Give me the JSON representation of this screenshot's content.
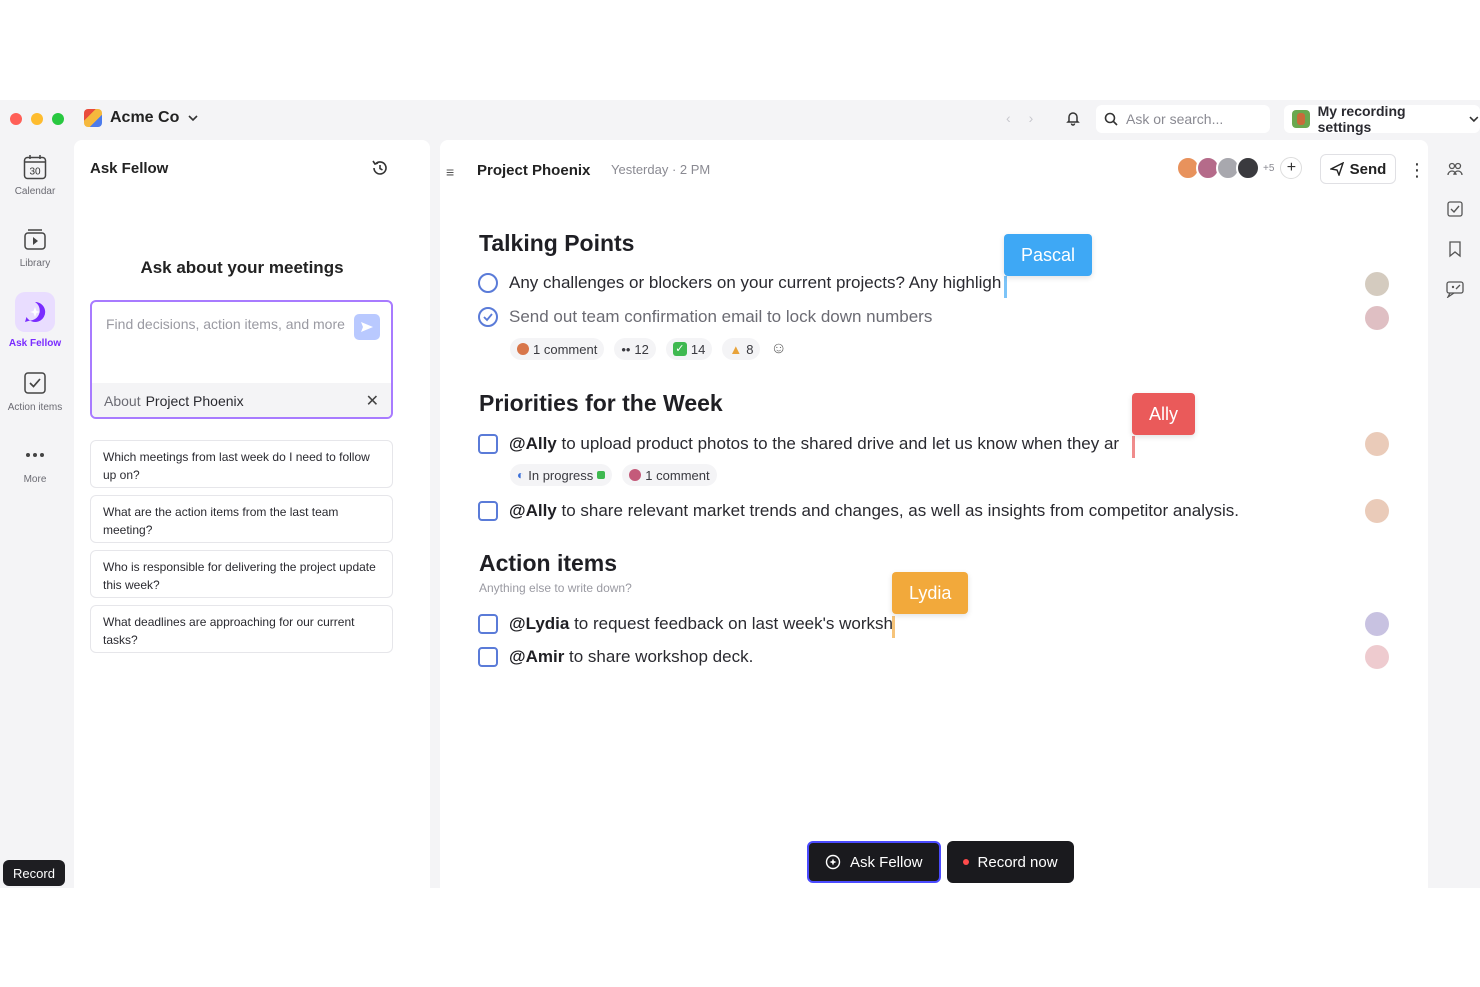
{
  "titlebar": {
    "org_name": "Acme Co",
    "search_placeholder": "Ask or search...",
    "recording_settings": "My recording settings"
  },
  "rail": {
    "items": [
      {
        "label": "Calendar",
        "icon": "calendar-icon",
        "date": "30"
      },
      {
        "label": "Library",
        "icon": "library-icon"
      },
      {
        "label": "Ask Fellow",
        "icon": "ask-fellow-icon",
        "active": true
      },
      {
        "label": "Action items",
        "icon": "action-items-icon"
      },
      {
        "label": "More",
        "icon": "more-icon"
      }
    ],
    "record_label": "Record"
  },
  "ask_panel": {
    "title": "Ask Fellow",
    "heading": "Ask about your meetings",
    "input_placeholder": "Find decisions, action items, and more",
    "about_prefix": "About",
    "about_value": "Project Phoenix",
    "suggestions": [
      "Which meetings from last week do I need to follow up on?",
      "What are the action items from the last team meeting?",
      "Who is responsible for delivering the project update this week?",
      "What deadlines are approaching for our current tasks?"
    ]
  },
  "doc": {
    "title": "Project Phoenix",
    "date": "Yesterday · 2 PM",
    "attendee_more": "+5",
    "send_label": "Send",
    "sections": {
      "talking_points": {
        "title": "Talking Points",
        "items": [
          {
            "text": "Any challenges or blockers on your current projects? Any highligh",
            "done": false
          },
          {
            "text": "Send out team confirmation email to lock down numbers",
            "done": true
          }
        ],
        "chips": {
          "comments": "1 comment",
          "eyes": "12",
          "check": "14",
          "thumbs": "8"
        }
      },
      "priorities": {
        "title": "Priorities for the Week",
        "items": [
          {
            "mention": "@Ally",
            "text": " to upload product photos to the shared drive and let us know when they ar"
          },
          {
            "mention": "@Ally",
            "text": " to share relevant market trends and changes, as well as insights from competitor analysis."
          }
        ],
        "chips": {
          "status": "In progress",
          "comments": "1 comment"
        }
      },
      "action_items": {
        "title": "Action items",
        "subtitle": "Anything else to write down?",
        "items": [
          {
            "mention": "@Lydia",
            "text": " to request feedback on last week's worksh"
          },
          {
            "mention": "@Amir",
            "text": " to share workshop deck."
          }
        ]
      }
    },
    "cursors": {
      "pascal": {
        "name": "Pascal",
        "color": "#3ea8f5"
      },
      "ally": {
        "name": "Ally",
        "color": "#ea5a5a"
      },
      "lydia": {
        "name": "Lydia",
        "color": "#f2a93b"
      }
    }
  },
  "floating_bar": {
    "ask_label": "Ask Fellow",
    "record_label": "Record now"
  }
}
